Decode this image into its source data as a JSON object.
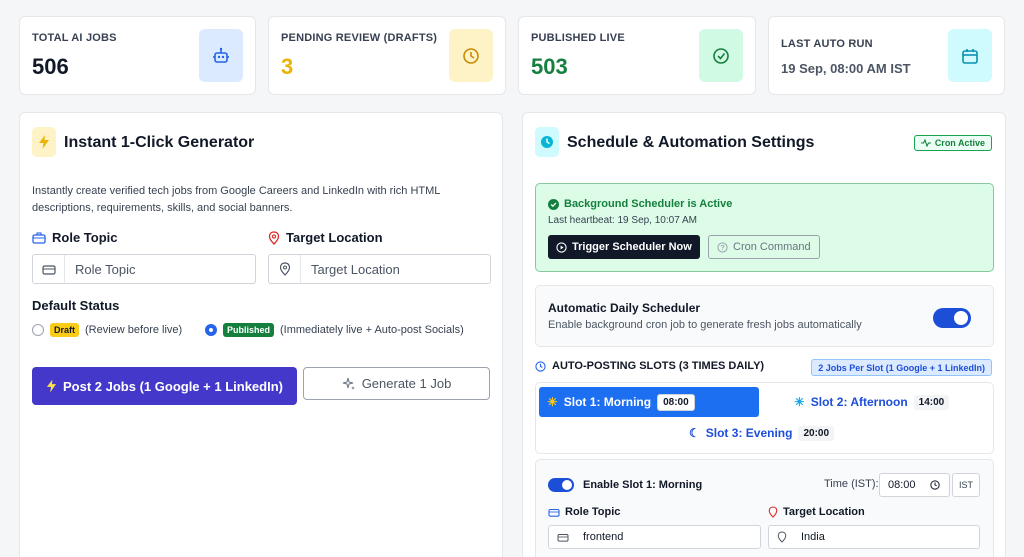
{
  "stats": [
    {
      "label": "TOTAL AI JOBS",
      "value": "506",
      "icon": "robot-icon"
    },
    {
      "label": "PENDING REVIEW (DRAFTS)",
      "value": "3",
      "icon": "clock-icon"
    },
    {
      "label": "PUBLISHED LIVE",
      "value": "503",
      "icon": "check-circle-icon"
    },
    {
      "label": "LAST AUTO RUN",
      "value": "19 Sep, 08:00 AM IST",
      "icon": "calendar-icon"
    }
  ],
  "generator": {
    "title": "Instant 1-Click Generator",
    "description": "Instantly create verified tech jobs from Google Careers and LinkedIn with rich HTML descriptions, requirements, skills, and social banners.",
    "role_label": "Role Topic",
    "role_placeholder": "Role Topic",
    "location_label": "Target Location",
    "location_placeholder": "Target Location",
    "status_label": "Default Status",
    "draft_tag": "Draft",
    "draft_text": "(Review before live)",
    "published_tag": "Published",
    "published_text": "(Immediately live + Auto-post Socials)",
    "selected_status": "Published",
    "post_button": "Post 2 Jobs (1 Google + 1 LinkedIn)",
    "generate_button": "Generate 1 Job"
  },
  "schedule": {
    "title": "Schedule & Automation Settings",
    "cron_badge": "Cron Active",
    "status_title": "Background Scheduler is Active",
    "heartbeat": "Last heartbeat: 19 Sep, 10:07 AM",
    "trigger_button": "Trigger Scheduler Now",
    "cron_button": "Cron Command",
    "auto_title": "Automatic Daily Scheduler",
    "auto_sub": "Enable background cron job to generate fresh jobs automatically",
    "auto_enabled": true,
    "slots_header": "AUTO-POSTING SLOTS (3 TIMES DAILY)",
    "slots_badge": "2 Jobs Per Slot (1 Google + 1 LinkedIn)",
    "slots": [
      {
        "label": "Slot 1: Morning",
        "time": "08:00",
        "active": true
      },
      {
        "label": "Slot 2: Afternoon",
        "time": "14:00",
        "active": false
      },
      {
        "label": "Slot 3: Evening",
        "time": "20:00",
        "active": false
      }
    ],
    "slot_detail": {
      "enable_label": "Enable Slot 1: Morning",
      "time_label": "Time (IST):",
      "time_value": "08:00",
      "tz": "IST",
      "role_label": "Role Topic",
      "role_value": "frontend",
      "location_label": "Target Location",
      "location_value": "India"
    }
  },
  "colors": {
    "primary": "#4338ca",
    "accent_blue": "#1d6ff2",
    "success": "#15803d",
    "pending": "#eab308"
  }
}
